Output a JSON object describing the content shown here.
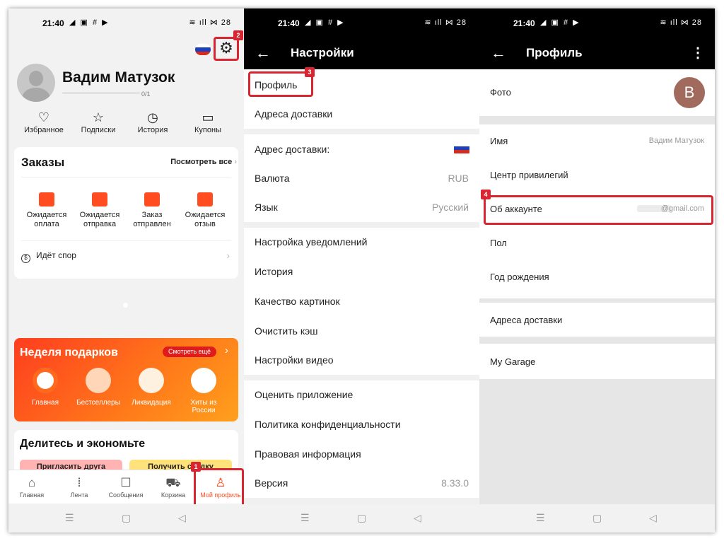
{
  "status_bar": {
    "time": "21:40",
    "left_icons": "◢ ▣ # ▶",
    "right_icons": "≋ ıll ⋈ 28"
  },
  "panel1": {
    "username": "Вадим Матузок",
    "progress_text": "0/1",
    "badge_settings": "2",
    "badge_profile_tab": "1",
    "quick_links": [
      {
        "label": "Избранное",
        "icon": "heart-icon"
      },
      {
        "label": "Подписки",
        "icon": "star-icon"
      },
      {
        "label": "История",
        "icon": "clock-icon"
      },
      {
        "label": "Купоны",
        "icon": "coupon-icon"
      }
    ],
    "orders": {
      "title": "Заказы",
      "see_all": "Посмотреть все",
      "items": [
        {
          "label": "Ожидается оплата"
        },
        {
          "label": "Ожидается отправка"
        },
        {
          "label": "Заказ отправлен"
        },
        {
          "label": "Ожидается отзыв"
        }
      ],
      "dispute": "Идёт спор"
    },
    "gifts": {
      "title": "Неделя подарков",
      "button": "Смотреть ещё",
      "items": [
        {
          "label": "Главная"
        },
        {
          "label": "Бестселлеры"
        },
        {
          "label": "Ликвидация"
        },
        {
          "label": "Хиты из России"
        }
      ]
    },
    "share": {
      "title": "Делитесь и экономьте",
      "btn1": "Пригласить друга",
      "btn2": "Получить скидку"
    },
    "tabs": [
      {
        "label": "Главная",
        "icon": "home-icon"
      },
      {
        "label": "Лента",
        "icon": "feed-icon"
      },
      {
        "label": "Сообщения",
        "icon": "chat-icon"
      },
      {
        "label": "Корзина",
        "icon": "cart-icon"
      },
      {
        "label": "Мой профиль",
        "icon": "user-icon"
      }
    ]
  },
  "panel2": {
    "title": "Настройки",
    "badge": "3",
    "rows": [
      {
        "label": "Профиль",
        "value": ""
      },
      {
        "label": "Адреса доставки",
        "value": ""
      },
      {
        "label": "Адрес доставки:",
        "value": ""
      },
      {
        "label": "Валюта",
        "value": "RUB"
      },
      {
        "label": "Язык",
        "value": "Русский"
      },
      {
        "label": "Настройка уведомлений",
        "value": ""
      },
      {
        "label": "История",
        "value": ""
      },
      {
        "label": "Качество картинок",
        "value": ""
      },
      {
        "label": "Очистить кэш",
        "value": ""
      },
      {
        "label": "Настройки видео",
        "value": ""
      },
      {
        "label": "Оценить приложение",
        "value": ""
      },
      {
        "label": "Политика конфиденциальности",
        "value": ""
      },
      {
        "label": "Правовая информация",
        "value": ""
      },
      {
        "label": "Версия",
        "value": "8.33.0"
      }
    ]
  },
  "panel3": {
    "title": "Профиль",
    "badge": "4",
    "avatar_letter": "B",
    "rows": [
      {
        "label": "Фото",
        "value": ""
      },
      {
        "label": "Имя",
        "value": "Вадим Матузок"
      },
      {
        "label": "Центр привилегий",
        "value": ""
      },
      {
        "label": "Об аккаунте",
        "value": "@gmail.com"
      },
      {
        "label": "Пол",
        "value": ""
      },
      {
        "label": "Год рождения",
        "value": ""
      },
      {
        "label": "Адреса доставки",
        "value": ""
      },
      {
        "label": "My Garage",
        "value": ""
      }
    ]
  },
  "colors": {
    "accent": "#ff4c21",
    "highlight": "#d9252f",
    "avatar_bg": "#a06a5c"
  }
}
